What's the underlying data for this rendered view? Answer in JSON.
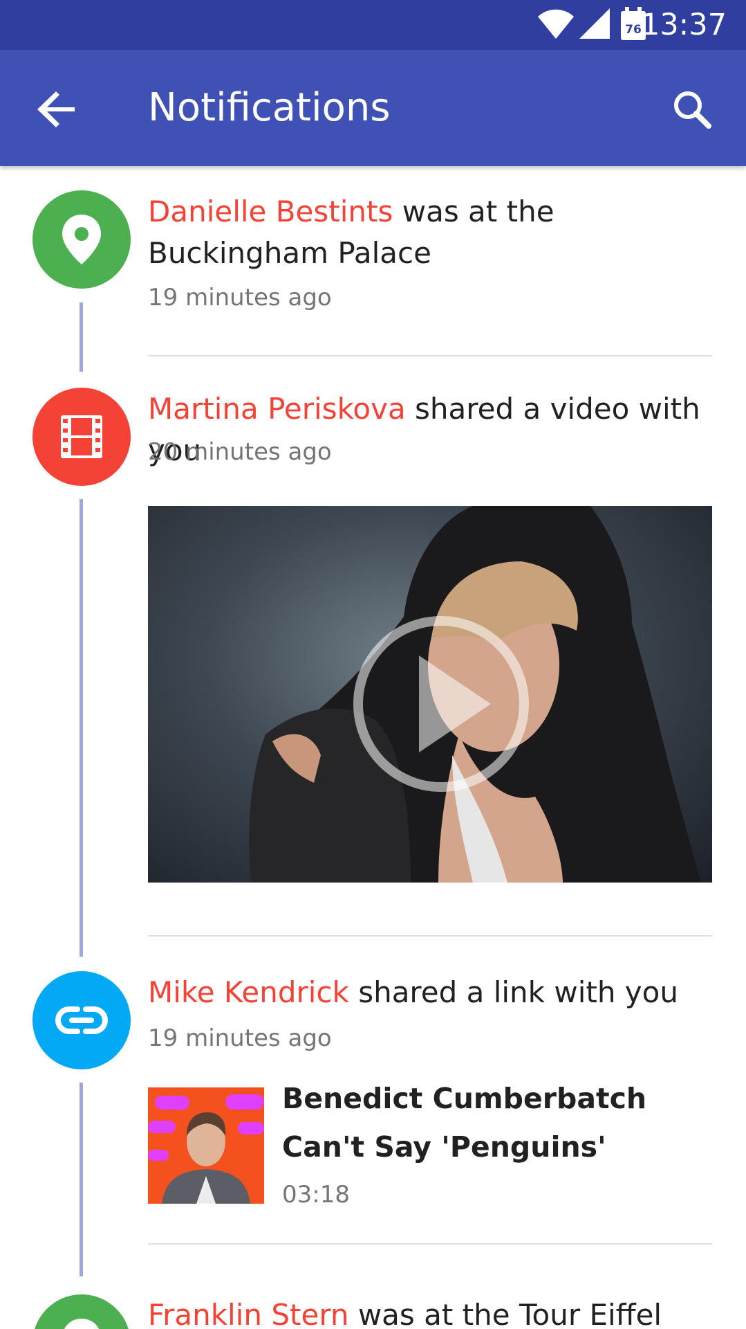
{
  "status_bar": {
    "time": "13:37",
    "calendar_day": "76"
  },
  "app_bar": {
    "title": "Notifications"
  },
  "notifications": [
    {
      "name": "Danielle Bestints",
      "message": " was at the Buckingham Palace",
      "time": "19 minutes ago",
      "icon": "location-pin-icon",
      "color": "#4caf50"
    },
    {
      "name": "Martina Periskova",
      "message": " shared a video with you",
      "time": "20 minutes ago",
      "icon": "film-icon",
      "color": "#f44336"
    },
    {
      "name": "Mike Kendrick",
      "message": " shared a link with you",
      "time": "19 minutes ago",
      "icon": "link-icon",
      "color": "#03a9f4",
      "link": {
        "title": "Benedict Cumberbatch Can't Say 'Penguins'",
        "duration": "03:18"
      }
    },
    {
      "name": "Franklin Stern",
      "message": " was at the Tour Eiffel",
      "icon": "location-pin-icon",
      "color": "#4caf50"
    }
  ],
  "colors": {
    "primary": "#3f51b5",
    "primary_dark": "#303f9f",
    "accent_name": "#f44336",
    "timeline": "#9fa8da"
  }
}
